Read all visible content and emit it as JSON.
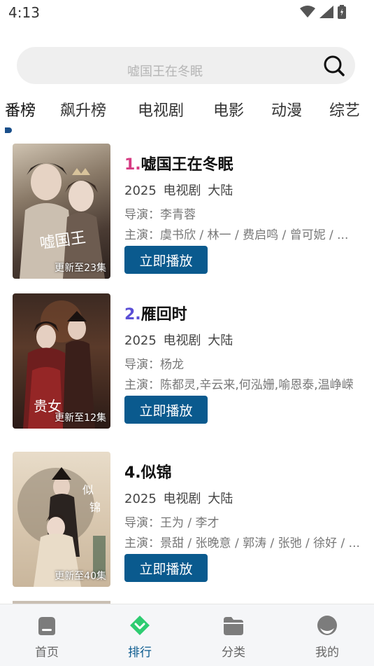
{
  "status": {
    "time": "4:13"
  },
  "search": {
    "hint": "嘘国王在冬眠"
  },
  "tabs": [
    "番榜",
    "飙升榜",
    "电视剧",
    "电影",
    "动漫",
    "综艺"
  ],
  "items": [
    {
      "rank": "1.",
      "rank_color": "#d63c83",
      "title": "嘘国王在冬眠",
      "meta": "2025 电视剧 大陆",
      "director": "导演：李青蓉",
      "cast": "主演：虞书欣 / 林一 / 费启鸣 / 曾可妮 / ...",
      "badge": "更新至23集",
      "play": "立即播放"
    },
    {
      "rank": "2.",
      "rank_color": "#5b4fd6",
      "title": "雁回时",
      "meta": "2025 电视剧 大陆",
      "director": "导演：杨龙",
      "cast": "主演：陈都灵,辛云来,何泓姗,喻恩泰,温峥嵘",
      "badge": "更新至12集",
      "play": "立即播放"
    },
    {
      "rank": "4.",
      "rank_color": "#111111",
      "title": "似锦",
      "meta": "2025 电视剧 大陆",
      "director": "导演：王为 / 李才",
      "cast": "主演：景甜 / 张晚意 / 郭涛 / 张弛 / 徐好 / ...",
      "badge": "更新至40集",
      "play": "立即播放"
    }
  ],
  "nav": [
    {
      "label": "首页",
      "icon": "home-icon"
    },
    {
      "label": "排行",
      "icon": "ranking-icon"
    },
    {
      "label": "分类",
      "icon": "folder-icon"
    },
    {
      "label": "我的",
      "icon": "profile-icon"
    }
  ],
  "colors": {
    "accent": "#0a5a8e",
    "active_nav": "#2ecc71"
  }
}
